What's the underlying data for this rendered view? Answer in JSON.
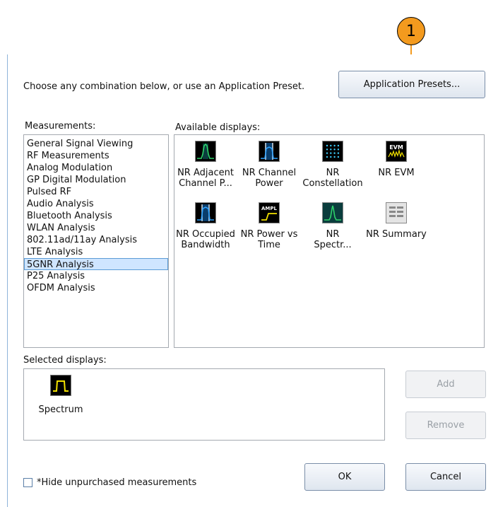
{
  "callout": {
    "number": "1"
  },
  "instruction": "Choose any combination below, or use an Application Preset.",
  "buttons": {
    "app_presets": "Application Presets...",
    "add": "Add",
    "remove": "Remove",
    "ok": "OK",
    "cancel": "Cancel"
  },
  "measurements": {
    "label": "Measurements:",
    "selected_index": 11,
    "items": [
      "General Signal Viewing",
      "RF Measurements",
      "Analog Modulation",
      "GP Digital Modulation",
      "Pulsed RF",
      "Audio Analysis",
      "Bluetooth Analysis",
      "WLAN Analysis",
      "802.11ad/11ay Analysis",
      "LTE Analysis",
      "5GNR Analysis",
      "P25 Analysis",
      "OFDM Analysis"
    ]
  },
  "available": {
    "label": "Available displays:",
    "displays": [
      {
        "icon": "adjacent-channel-icon",
        "line1": "NR Adjacent",
        "line2": "Channel P..."
      },
      {
        "icon": "channel-power-icon",
        "line1": "NR Channel",
        "line2": "Power"
      },
      {
        "icon": "constellation-icon",
        "line1": "NR",
        "line2": "Constellation"
      },
      {
        "icon": "evm-icon",
        "line1": "NR EVM",
        "line2": "",
        "badge": "EVM"
      },
      {
        "icon": "occupied-bandwidth-icon",
        "line1": "NR Occupied",
        "line2": "Bandwidth"
      },
      {
        "icon": "power-vs-time-icon",
        "line1": "NR Power vs",
        "line2": "Time",
        "badge": "AMPL"
      },
      {
        "icon": "spectrum-icon",
        "line1": "NR",
        "line2": "Spectr..."
      },
      {
        "icon": "summary-icon",
        "line1": "NR Summary",
        "line2": ""
      }
    ]
  },
  "selected": {
    "label": "Selected displays:",
    "items": [
      {
        "icon": "spectrum-icon",
        "label": "Spectrum"
      }
    ]
  },
  "hide_unpurchased": {
    "label": "*Hide unpurchased measurements",
    "checked": false
  },
  "colors": {
    "callout": "#f39a1e",
    "selection": "#cfe5ff",
    "dialog_border": "#8fb4d9"
  }
}
